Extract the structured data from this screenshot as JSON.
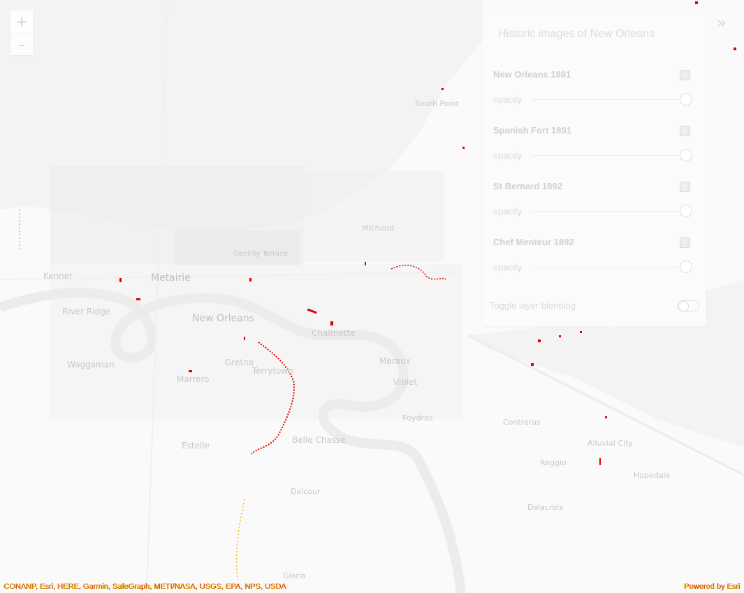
{
  "map": {
    "place_labels": [
      {
        "text": "South Point",
        "key": "south-point"
      },
      {
        "text": "Michoud",
        "key": "michoud"
      },
      {
        "text": "Gentilly Terrace",
        "key": "gentilly-terrace"
      },
      {
        "text": "Kenner",
        "key": "kenner"
      },
      {
        "text": "Metairie",
        "key": "metairie"
      },
      {
        "text": "River Ridge",
        "key": "river-ridge"
      },
      {
        "text": "New Orleans",
        "key": "new-orleans"
      },
      {
        "text": "Chalmette",
        "key": "chalmette"
      },
      {
        "text": "Waggaman",
        "key": "waggaman"
      },
      {
        "text": "Gretna",
        "key": "gretna"
      },
      {
        "text": "Marrero",
        "key": "marrero"
      },
      {
        "text": "Terrytown",
        "key": "terrytown"
      },
      {
        "text": "Meraux",
        "key": "meraux"
      },
      {
        "text": "Violet",
        "key": "violet"
      },
      {
        "text": "Poydras",
        "key": "poydras"
      },
      {
        "text": "Contreras",
        "key": "contreras"
      },
      {
        "text": "Estelle",
        "key": "estelle"
      },
      {
        "text": "Belle Chasse",
        "key": "belle-chasse"
      },
      {
        "text": "Alluvial City",
        "key": "alluvial-city"
      },
      {
        "text": "Reggio",
        "key": "reggio"
      },
      {
        "text": "Hopedale",
        "key": "hopedale"
      },
      {
        "text": "Dalcour",
        "key": "dalcour"
      },
      {
        "text": "Delacroix",
        "key": "delacroix"
      },
      {
        "text": "Gloria",
        "key": "gloria"
      }
    ]
  },
  "zoom": {
    "in_symbol": "+",
    "out_symbol": "–"
  },
  "expand": {
    "symbol": "»"
  },
  "panel": {
    "title": "Historic images of New Orleans",
    "layers": [
      {
        "name": "New Orleans 1891",
        "checked": true,
        "opacity_label": "opacity",
        "opacity": 1.0
      },
      {
        "name": "Spanish Fort 1891",
        "checked": true,
        "opacity_label": "opacity",
        "opacity": 1.0
      },
      {
        "name": "St Bernard 1892",
        "checked": true,
        "opacity_label": "opacity",
        "opacity": 1.0
      },
      {
        "name": "Chef Menteur 1892",
        "checked": true,
        "opacity_label": "opacity",
        "opacity": 1.0
      }
    ],
    "blend_label": "Toggle layer blending",
    "blend_on": false
  },
  "attribution": {
    "text": "CONANP, Esri, HERE, Garmin, SafeGraph, METI/NASA, USGS, EPA, NPS, USDA",
    "powered_by": "Powered by Esri"
  },
  "colors": {
    "map_bg": "#fafafa",
    "water": "#f3f3f3",
    "overlay": "#eeeeee",
    "highlight_red": "#e00000",
    "highlight_yellow": "#f0c000"
  }
}
